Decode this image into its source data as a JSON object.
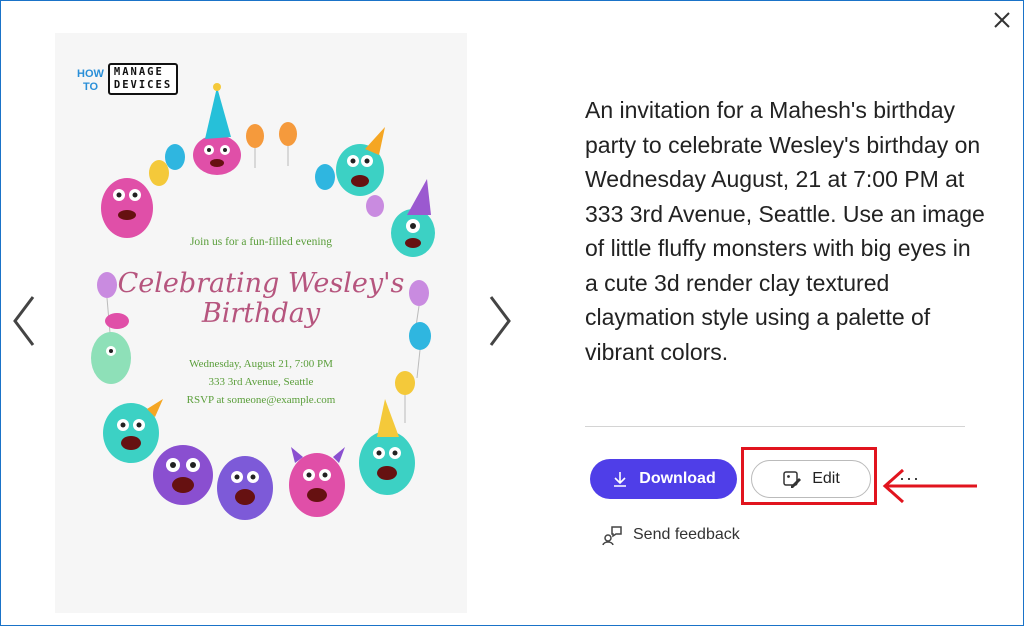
{
  "logo": {
    "how": "HOW",
    "to": "TO",
    "manage": "MANAGE",
    "devices": "DEVICES"
  },
  "invitation": {
    "subtitle": "Join us for a fun-filled evening",
    "title_line1": "Celebrating Wesley's",
    "title_line2": "Birthday",
    "date_line": "Wednesday, August 21, 7:00 PM",
    "address_line": "333 3rd Avenue, Seattle",
    "rsvp_line": "RSVP at someone@example.com"
  },
  "description": "An invitation for a Mahesh's birthday party to celebrate Wesley's birthday on Wednesday August, 21 at 7:00 PM at 333 3rd Avenue, Seattle. Use an image of little fluffy monsters with big eyes in a cute 3d render clay textured claymation style using a palette of vibrant colors.",
  "actions": {
    "download_label": "Download",
    "edit_label": "Edit",
    "more_label": "···",
    "feedback_label": "Send feedback"
  },
  "colors": {
    "primary": "#4f3ee8",
    "highlight": "#e1141e",
    "title_pink": "#b6557e",
    "green_text": "#5a9e3a"
  },
  "icons": [
    "close-icon",
    "chevron-left-icon",
    "chevron-right-icon",
    "download-icon",
    "edit-image-icon",
    "feedback-icon",
    "red-arrow-icon"
  ]
}
